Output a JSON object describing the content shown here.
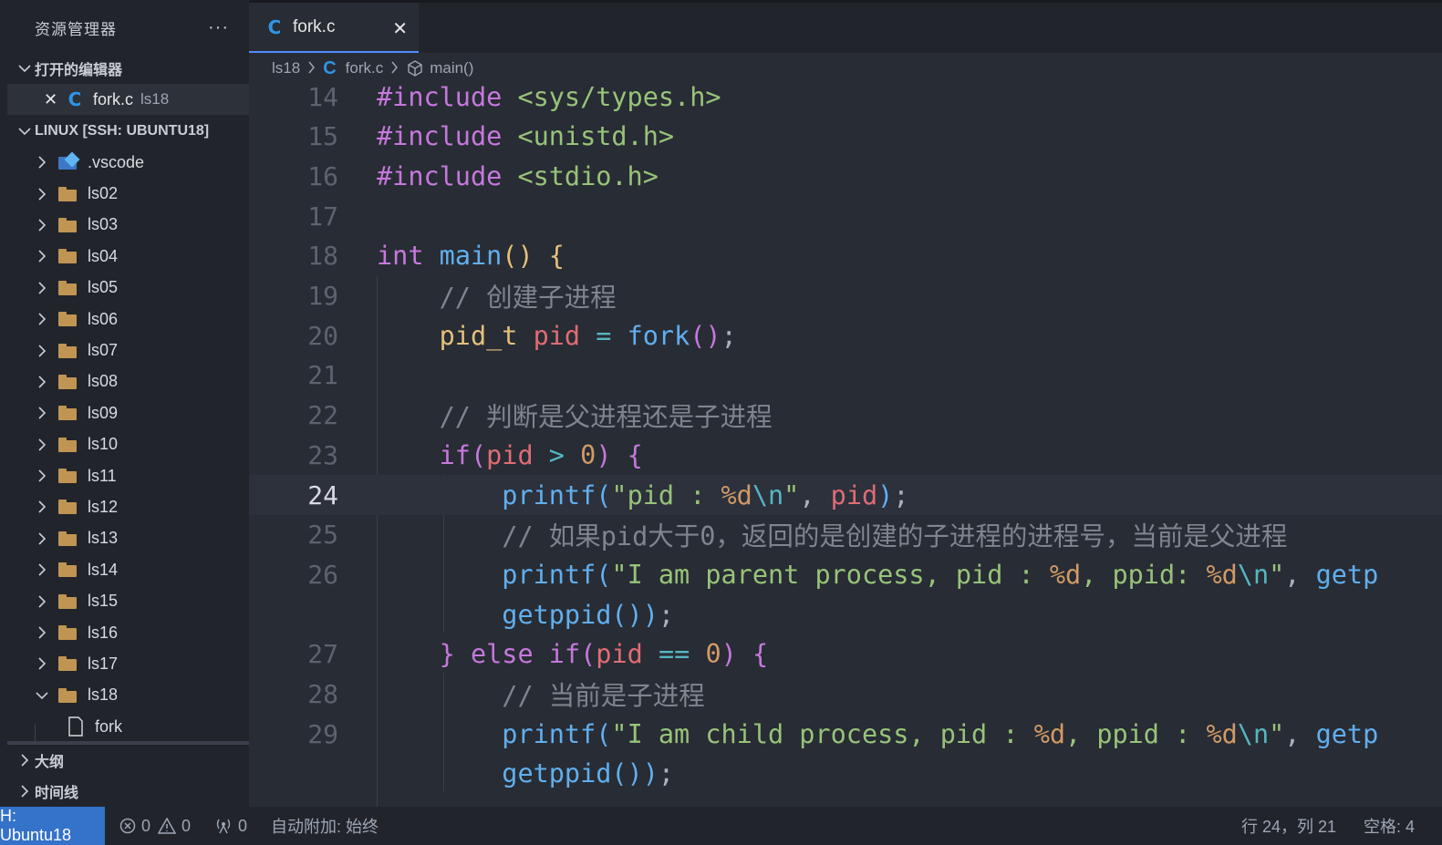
{
  "sidebar": {
    "header_title": "资源管理器",
    "more_label": "···",
    "open_editors_label": "打开的编辑器",
    "open_editor": {
      "name": "fork.c",
      "dir": "ls18"
    },
    "workspace_label": "LINUX [SSH: UBUNTU18]",
    "tree": [
      {
        "name": ".vscode",
        "type": "vscode-folder",
        "expanded": false
      },
      {
        "name": "ls02",
        "type": "folder",
        "expanded": false
      },
      {
        "name": "ls03",
        "type": "folder",
        "expanded": false
      },
      {
        "name": "ls04",
        "type": "folder",
        "expanded": false
      },
      {
        "name": "ls05",
        "type": "folder",
        "expanded": false
      },
      {
        "name": "ls06",
        "type": "folder",
        "expanded": false
      },
      {
        "name": "ls07",
        "type": "folder",
        "expanded": false
      },
      {
        "name": "ls08",
        "type": "folder",
        "expanded": false
      },
      {
        "name": "ls09",
        "type": "folder",
        "expanded": false
      },
      {
        "name": "ls10",
        "type": "folder",
        "expanded": false
      },
      {
        "name": "ls11",
        "type": "folder",
        "expanded": false
      },
      {
        "name": "ls12",
        "type": "folder",
        "expanded": false
      },
      {
        "name": "ls13",
        "type": "folder",
        "expanded": false
      },
      {
        "name": "ls14",
        "type": "folder",
        "expanded": false
      },
      {
        "name": "ls15",
        "type": "folder",
        "expanded": false
      },
      {
        "name": "ls16",
        "type": "folder",
        "expanded": false
      },
      {
        "name": "ls17",
        "type": "folder",
        "expanded": false
      },
      {
        "name": "ls18",
        "type": "folder",
        "expanded": true
      },
      {
        "name": "fork",
        "type": "file",
        "expanded": false
      }
    ],
    "outline_label": "大纲",
    "timeline_label": "时间线"
  },
  "tab": {
    "icon": "C",
    "label": "fork.c",
    "close": "✕"
  },
  "breadcrumb": {
    "folder": "ls18",
    "file": "fork.c",
    "symbol": "main()"
  },
  "editor": {
    "active_line": "24",
    "lines": [
      {
        "n": "14",
        "html": "<span class=\"pp\">#include</span> <span class=\"str\">&lt;sys/types.h&gt;</span>"
      },
      {
        "n": "15",
        "html": "<span class=\"pp\">#include</span> <span class=\"str\">&lt;unistd.h&gt;</span>"
      },
      {
        "n": "16",
        "html": "<span class=\"pp\">#include</span> <span class=\"str\">&lt;stdio.h&gt;</span>"
      },
      {
        "n": "17",
        "html": ""
      },
      {
        "n": "18",
        "html": "<span class=\"kw\">int</span> <span class=\"fn\">main</span><span class=\"br1\">()</span> <span class=\"br1\">{</span>"
      },
      {
        "n": "19",
        "html": "    <span class=\"cm\">// 创建子进程</span>"
      },
      {
        "n": "20",
        "html": "    <span class=\"type\">pid_t</span> <span class=\"var\">pid</span> <span class=\"op\">=</span> <span class=\"fn\">fork</span><span class=\"br2\">()</span>;"
      },
      {
        "n": "21",
        "html": ""
      },
      {
        "n": "22",
        "html": "    <span class=\"cm\">// 判断是父进程还是子进程</span>"
      },
      {
        "n": "23",
        "html": "    <span class=\"kw\">if</span><span class=\"br2\">(</span><span class=\"var\">pid</span> <span class=\"op\">&gt;</span> <span class=\"num\">0</span><span class=\"br2\">)</span> <span class=\"br2\">{</span>"
      },
      {
        "n": "24",
        "html": "        <span class=\"fn\">printf</span><span class=\"br3\">(</span><span class=\"str\">\"pid : </span><span class=\"num\">%d</span><span class=\"esc\">\\n</span><span class=\"str\">\"</span>, <span class=\"var\">pid</span><span class=\"br3\">)</span>;"
      },
      {
        "n": "25",
        "html": "        <span class=\"cm\">// 如果pid大于0，返回的是创建的子进程的进程号，当前是父进程</span>"
      },
      {
        "n": "26",
        "html": "        <span class=\"fn\">printf</span><span class=\"br3\">(</span><span class=\"str\">\"I am parent process, pid : </span><span class=\"num\">%d</span><span class=\"str\">, ppid: </span><span class=\"num\">%d</span><span class=\"esc\">\\n</span><span class=\"str\">\"</span>, <span class=\"fn\">getp</span>"
      },
      {
        "n": "",
        "html": "        <span class=\"fn\">getppid</span><span class=\"br3\">()</span><span class=\"br3\">)</span>;"
      },
      {
        "n": "27",
        "html": "    <span class=\"br2\">}</span> <span class=\"kw\">else</span> <span class=\"kw\">if</span><span class=\"br2\">(</span><span class=\"var\">pid</span> <span class=\"op\">==</span> <span class=\"num\">0</span><span class=\"br2\">)</span> <span class=\"br2\">{</span>"
      },
      {
        "n": "28",
        "html": "        <span class=\"cm\">// 当前是子进程</span>"
      },
      {
        "n": "29",
        "html": "        <span class=\"fn\">printf</span><span class=\"br3\">(</span><span class=\"str\">\"I am child process, pid : </span><span class=\"num\">%d</span><span class=\"str\">, ppid : </span><span class=\"num\">%d</span><span class=\"esc\">\\n</span><span class=\"str\">\"</span>, <span class=\"fn\">getp</span>"
      },
      {
        "n": "",
        "html": "        <span class=\"fn\">getppid</span><span class=\"br3\">()</span><span class=\"br3\">)</span>;"
      }
    ]
  },
  "statusbar": {
    "remote": "H: Ubuntu18",
    "errors": "0",
    "warnings": "0",
    "ports": "0",
    "auto_attach": "自动附加: 始终",
    "position": "行 24，列 21",
    "spaces": "空格: 4"
  },
  "colors": {
    "accent": "#3572c9",
    "c_icon": "#2f95e6",
    "folder": "#c09553"
  }
}
